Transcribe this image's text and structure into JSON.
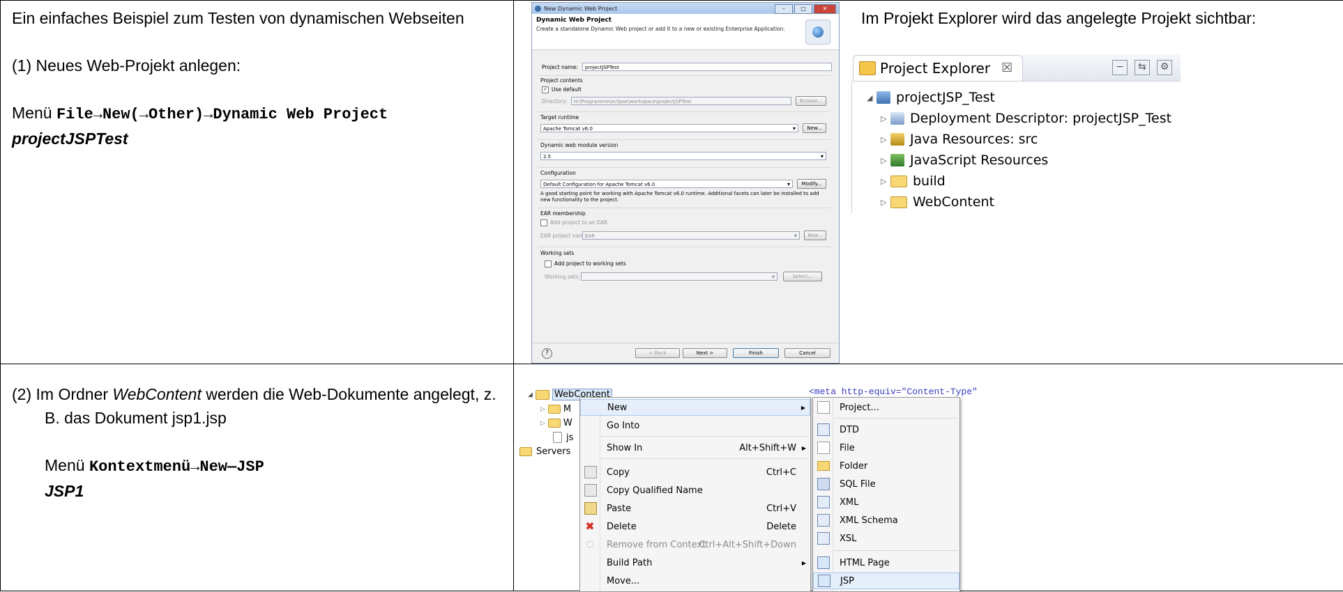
{
  "row1": {
    "left": {
      "intro": "Ein einfaches Beispiel zum Testen von dynamischen Webseiten",
      "step": "(1)  Neues Web-Projekt anlegen:",
      "menu_prefix": "Menü ",
      "menu_path": "File→New(→Other)→Dynamic Web Project",
      "project_name": "projectJSPTest"
    },
    "dialog": {
      "window_title": "New Dynamic Web Project",
      "header_title": "Dynamic Web Project",
      "header_desc": "Create a standalone Dynamic Web project or add it to a new or existing Enterprise Application.",
      "project_name_label": "Project name:",
      "project_name_value": "projectJSPTest",
      "project_contents_label": "Project contents",
      "use_default_label": "Use default",
      "directory_label": "Directory:",
      "directory_value": "H:\\Programme\\eclipse\\workspace\\projectJSPTest",
      "browse_label": "Browse...",
      "target_runtime_label": "Target runtime",
      "target_runtime_value": "Apache Tomcat v6.0",
      "new_label": "New...",
      "module_version_label": "Dynamic web module version",
      "module_version_value": "2.5",
      "configuration_label": "Configuration",
      "configuration_value": "Default Configuration for Apache Tomcat v6.0",
      "modify_label": "Modify...",
      "configuration_desc": "A good starting point for working with Apache Tomcat v6.0 runtime. Additional facets can later be installed to add new functionality to the project.",
      "ear_membership_label": "EAR membership",
      "add_to_ear_label": "Add project to an EAR",
      "ear_project_name_label": "EAR project name:",
      "ear_project_name_value": "EAR",
      "working_sets_label": "Working sets",
      "add_working_sets_label": "Add project to working sets",
      "working_sets_field_label": "Working sets:",
      "select_label": "Select...",
      "back_label": "< Back",
      "next_label": "Next >",
      "finish_label": "Finish",
      "cancel_label": "Cancel",
      "help_glyph": "?"
    },
    "right": {
      "text": "Im Projekt Explorer wird das angelegte Projekt sichtbar:",
      "explorer_tab": "Project Explorer",
      "close_glyph": "☒",
      "tree": {
        "project": "projectJSP_Test",
        "children": [
          {
            "label": "Deployment Descriptor: projectJSP_Test",
            "icon": "deployment-descriptor-icon"
          },
          {
            "label": "Java Resources: src",
            "icon": "java-resources-icon"
          },
          {
            "label": "JavaScript Resources",
            "icon": "javascript-resources-icon"
          },
          {
            "label": "build",
            "icon": "folder-icon"
          },
          {
            "label": "WebContent",
            "icon": "folder-icon"
          }
        ]
      }
    }
  },
  "row2": {
    "left": {
      "step": "(2)  Im Ordner ",
      "folder": "WebContent",
      "step_rest": " werden die Web-Dokumente angelegt, z. B. das Dokument jsp1.jsp",
      "menu_prefix": "Menü ",
      "menu_path": "Kontextmenü→New—JSP",
      "file_name": "JSP1"
    },
    "screenshot": {
      "webcontent_label": "WebContent",
      "tree_partial": [
        "M",
        "W",
        "js"
      ],
      "servers_label": "Servers",
      "code_snippet": "<meta http-equiv=\"Content-Type\"",
      "context_menu": [
        {
          "label": "New",
          "accel": "",
          "submenu": true,
          "disabled": false,
          "selected": true
        },
        {
          "label": "Go Into",
          "accel": "",
          "submenu": false,
          "disabled": false
        },
        {
          "label": "Show In",
          "accel": "Alt+Shift+W",
          "submenu": true,
          "disabled": false
        },
        {
          "label": "Copy",
          "accel": "Ctrl+C",
          "submenu": false,
          "disabled": false
        },
        {
          "label": "Copy Qualified Name",
          "accel": "",
          "submenu": false,
          "disabled": false
        },
        {
          "label": "Paste",
          "accel": "Ctrl+V",
          "submenu": false,
          "disabled": false
        },
        {
          "label": "Delete",
          "accel": "Delete",
          "submenu": false,
          "disabled": false
        },
        {
          "label": "Remove from Context",
          "accel": "Ctrl+Alt+Shift+Down",
          "submenu": false,
          "disabled": true
        },
        {
          "label": "Build Path",
          "accel": "",
          "submenu": true,
          "disabled": false
        },
        {
          "label": "Move...",
          "accel": "",
          "submenu": false,
          "disabled": false
        }
      ],
      "submenu": [
        {
          "label": "Project..."
        },
        {
          "label": "DTD"
        },
        {
          "label": "File"
        },
        {
          "label": "Folder"
        },
        {
          "label": "SQL File"
        },
        {
          "label": "XML"
        },
        {
          "label": "XML Schema"
        },
        {
          "label": "XSL"
        },
        {
          "label": "HTML Page"
        },
        {
          "label": "JSP"
        }
      ]
    }
  }
}
